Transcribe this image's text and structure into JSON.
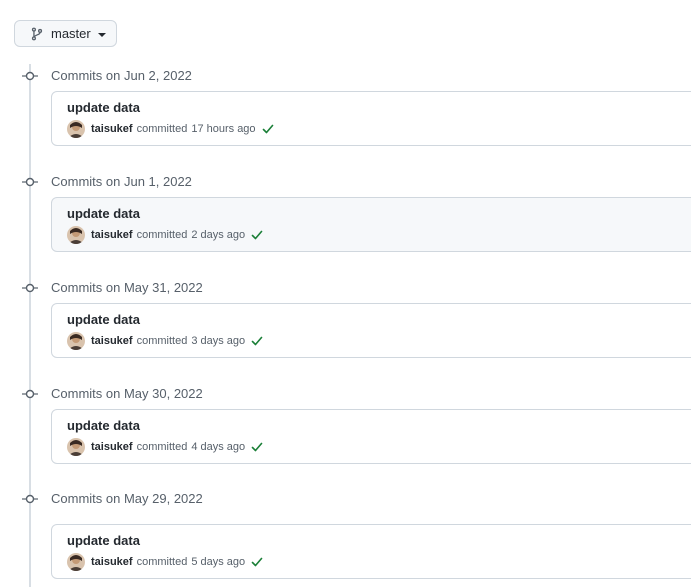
{
  "branch": {
    "label": "master",
    "icon": "git-branch-icon"
  },
  "commit_groups": [
    {
      "date": "Commits on Jun 2, 2022",
      "commit": {
        "title": "update data",
        "author": "taisukef",
        "verb": "committed",
        "time": "17 hours ago",
        "status": "success",
        "status_color": "#1a7f37"
      }
    },
    {
      "date": "Commits on Jun 1, 2022",
      "commit": {
        "title": "update data",
        "author": "taisukef",
        "verb": "committed",
        "time": "2 days ago",
        "status": "success",
        "status_color": "#1a7f37"
      }
    },
    {
      "date": "Commits on May 31, 2022",
      "commit": {
        "title": "update data",
        "author": "taisukef",
        "verb": "committed",
        "time": "3 days ago",
        "status": "success",
        "status_color": "#1a7f37"
      }
    },
    {
      "date": "Commits on May 30, 2022",
      "commit": {
        "title": "update data",
        "author": "taisukef",
        "verb": "committed",
        "time": "4 days ago",
        "status": "success",
        "status_color": "#1a7f37"
      }
    },
    {
      "date": "Commits on May 29, 2022",
      "commit": {
        "title": "update data",
        "author": "taisukef",
        "verb": "committed",
        "time": "5 days ago",
        "status": "success",
        "status_color": "#1a7f37"
      }
    }
  ]
}
